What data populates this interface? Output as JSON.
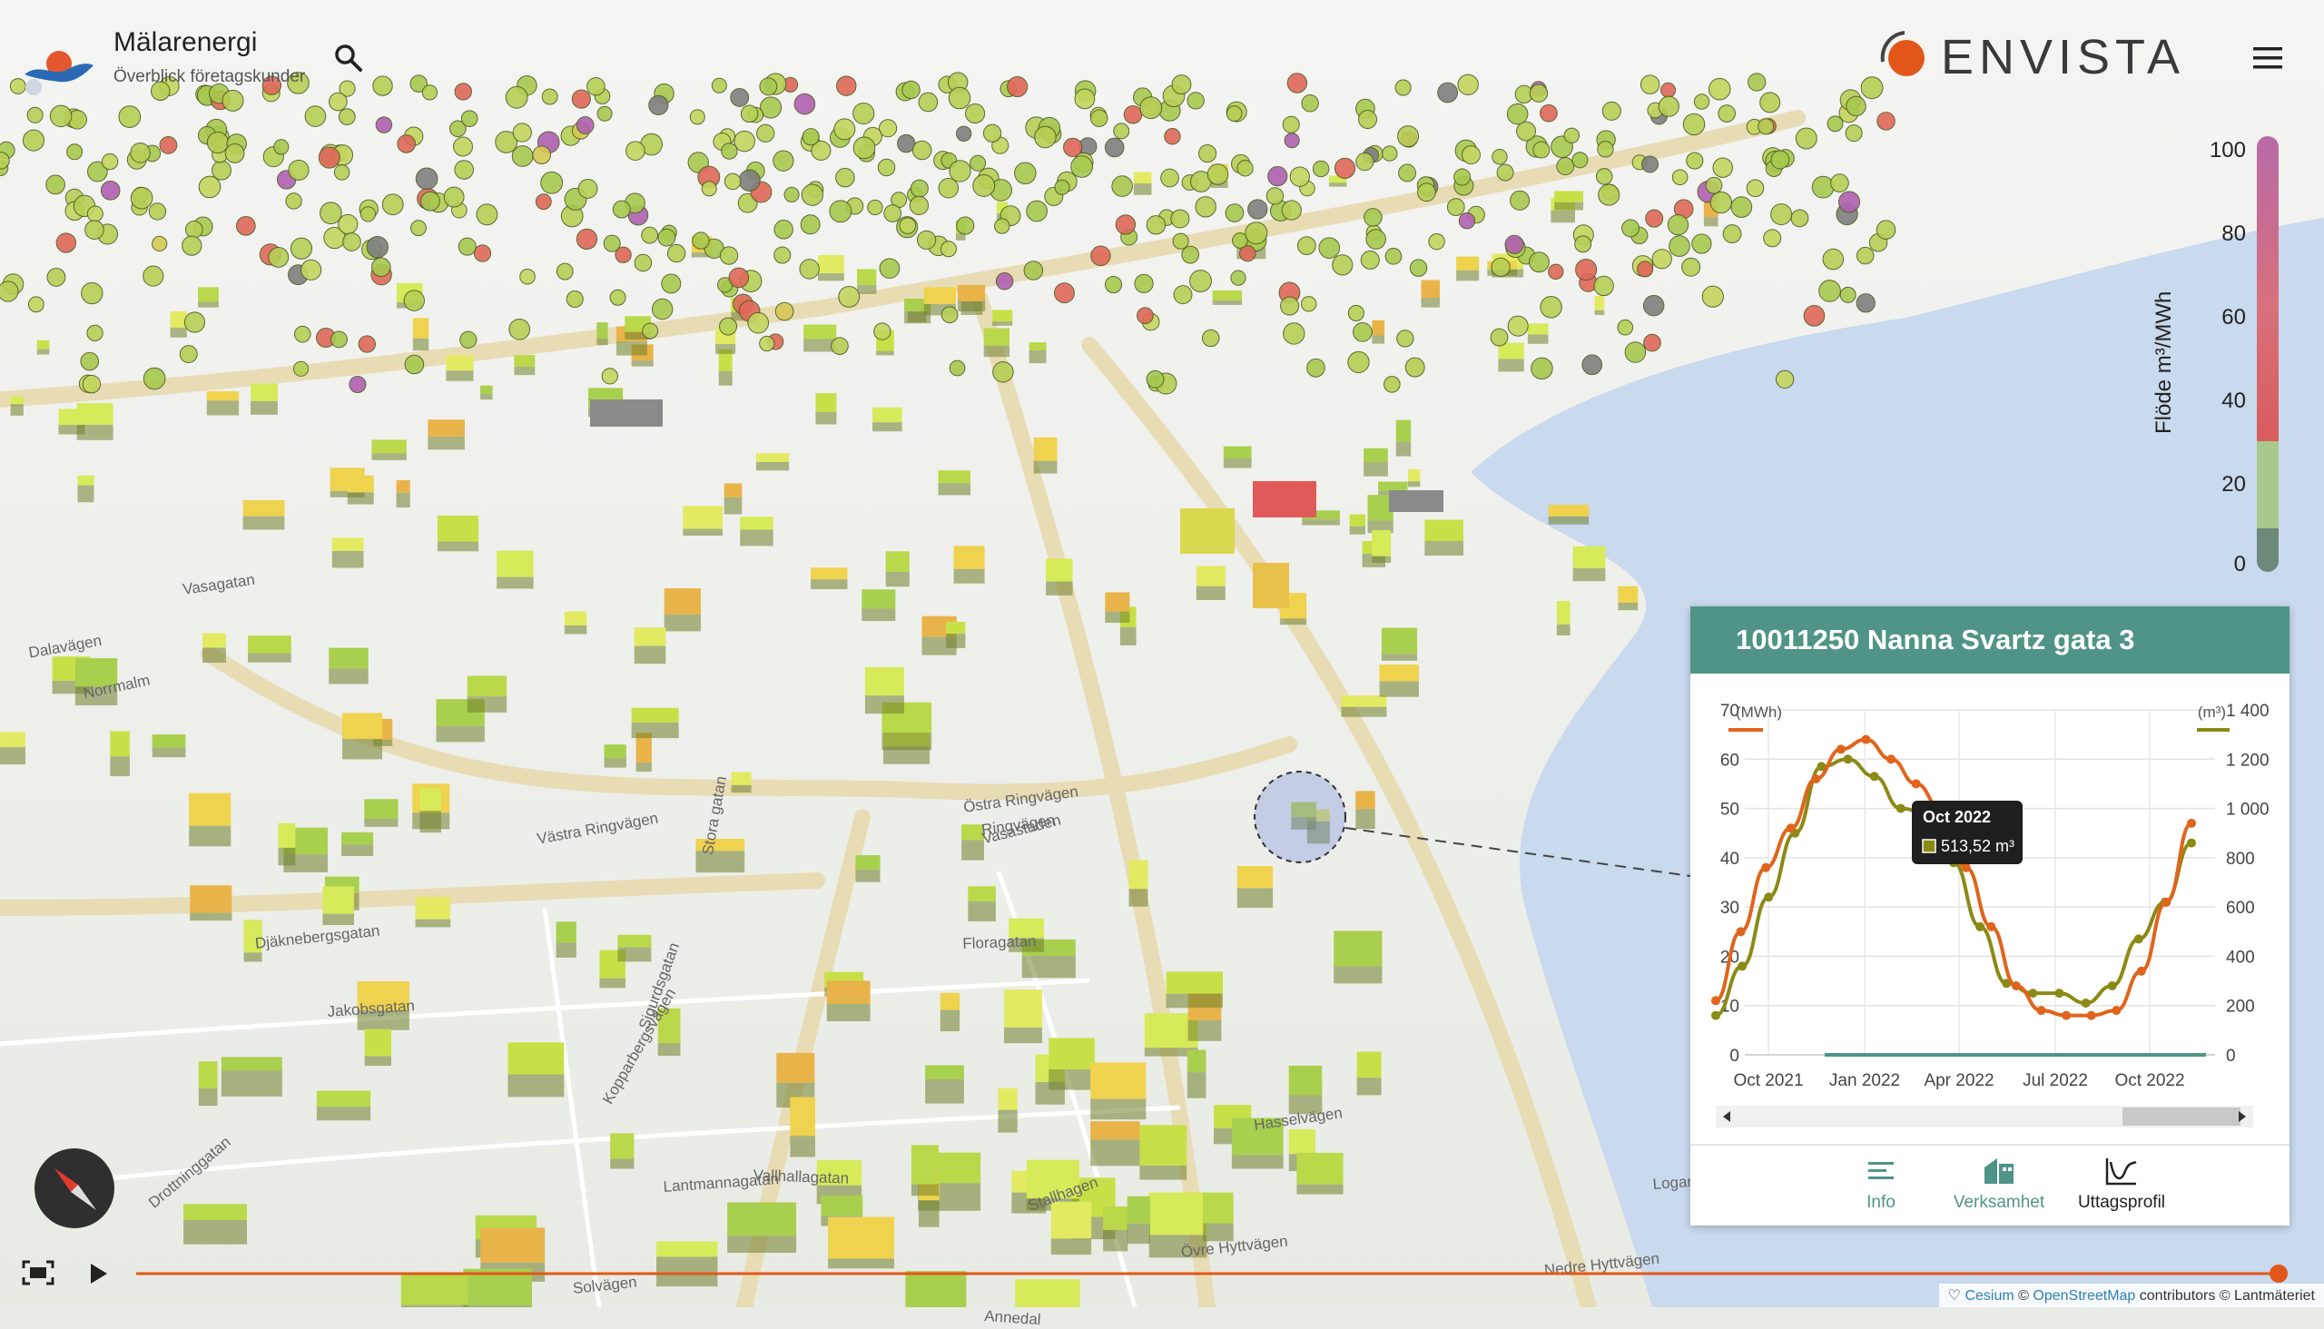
{
  "header": {
    "title": "Mälarenergi",
    "subtitle": "Överblick företagskunder",
    "brand": "ENVISTA"
  },
  "map": {
    "street_labels": [
      "Vasagatan",
      "Dalavägen",
      "Norrmalm",
      "Ringvägen",
      "Västra Ringvägen",
      "Stora gatan",
      "Djäknebergsgatan",
      "Jakobsgatan",
      "Kopparbergsvägen",
      "Östra Ringvägen",
      "Sigurdsgatan",
      "Floragatan",
      "Vasastaden",
      "Vallhallagatan",
      "Stallhagen",
      "Hasselvägen",
      "Drottninggatan",
      "Lantmannagatan",
      "Övre Hyttvägen",
      "Nedre Hyttvägen",
      "Solvägen",
      "Logaregatan",
      "Annedal"
    ]
  },
  "legend": {
    "title": "Flöde m³/MWh",
    "ticks": [
      "100",
      "80",
      "60",
      "40",
      "20",
      "0"
    ]
  },
  "panel": {
    "title": "10011250 Nanna Svartz gata 3",
    "tabs": [
      {
        "label": "Info",
        "icon": "list-icon",
        "active": false
      },
      {
        "label": "Verksamhet",
        "icon": "building-icon",
        "active": false
      },
      {
        "label": "Uttagsprofil",
        "icon": "profile-chart-icon",
        "active": true
      }
    ]
  },
  "chart_data": {
    "type": "line",
    "left_unit": "(MWh)",
    "right_unit": "(m³)",
    "y_left_ticks": [
      "70",
      "60",
      "50",
      "40",
      "30",
      "20",
      "10",
      "0"
    ],
    "y_right_ticks": [
      "1 400",
      "1 200",
      "1 000",
      "800",
      "600",
      "400",
      "200",
      "0"
    ],
    "x_labels": [
      "Oct 2021",
      "Jan 2022",
      "Apr 2022",
      "Jul 2022",
      "Oct 2022"
    ],
    "ylim_left": [
      0,
      70
    ],
    "ylim_right": [
      0,
      1400
    ],
    "series": [
      {
        "axis": "left",
        "color": "#e0641c",
        "values": [
          11,
          25,
          38,
          46,
          56,
          62,
          64,
          60,
          55,
          50,
          38,
          26,
          14,
          9,
          8,
          8,
          9,
          17,
          31,
          47
        ]
      },
      {
        "axis": "right",
        "color": "#8a8a16",
        "values": [
          160,
          360,
          640,
          900,
          1170,
          1200,
          1130,
          1000,
          980,
          780,
          520,
          290,
          250,
          250,
          210,
          280,
          470,
          620,
          860
        ]
      }
    ],
    "tooltip": {
      "title": "Oct 2022",
      "value": "513,52 m³"
    }
  },
  "timeline": {
    "progress": 1.0
  },
  "attribution": {
    "prefix": "♡",
    "cesium": "Cesium",
    "osm": "OpenStreetMap",
    "rest": "contributors © Lantmäteriet"
  }
}
